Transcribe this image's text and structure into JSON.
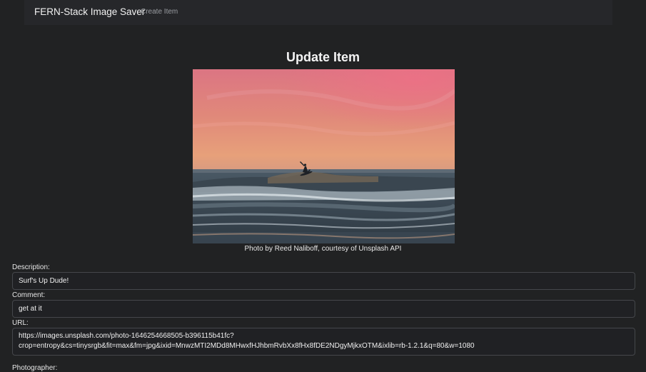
{
  "navbar": {
    "brand": "FERN-Stack Image Saver",
    "links": [
      "Create Item"
    ]
  },
  "page": {
    "title": "Update Item"
  },
  "image": {
    "caption": "Photo by Reed Naliboff, courtesy of Unsplash API"
  },
  "form": {
    "description_label": "Description:",
    "description_value": "Surf's Up Dude!",
    "comment_label": "Comment:",
    "comment_value": "get at it",
    "url_label": "URL:",
    "url_value_line1": "https://images.unsplash.com/photo-1646254668505-b396115b41fc?",
    "url_value_line2": "crop=entropy&cs=tinysrgb&fit=max&fm=jpg&ixid=MnwzMTI2MDd8MHwxfHJhbmRvbXx8fHx8fDE2NDgyMjkxOTM&ixlib=rb-1.2.1&q=80&w=1080",
    "photographer_label": "Photographer:"
  },
  "colors": {
    "background": "#212223",
    "navbar": "#26272a",
    "input_border": "#45474b"
  }
}
